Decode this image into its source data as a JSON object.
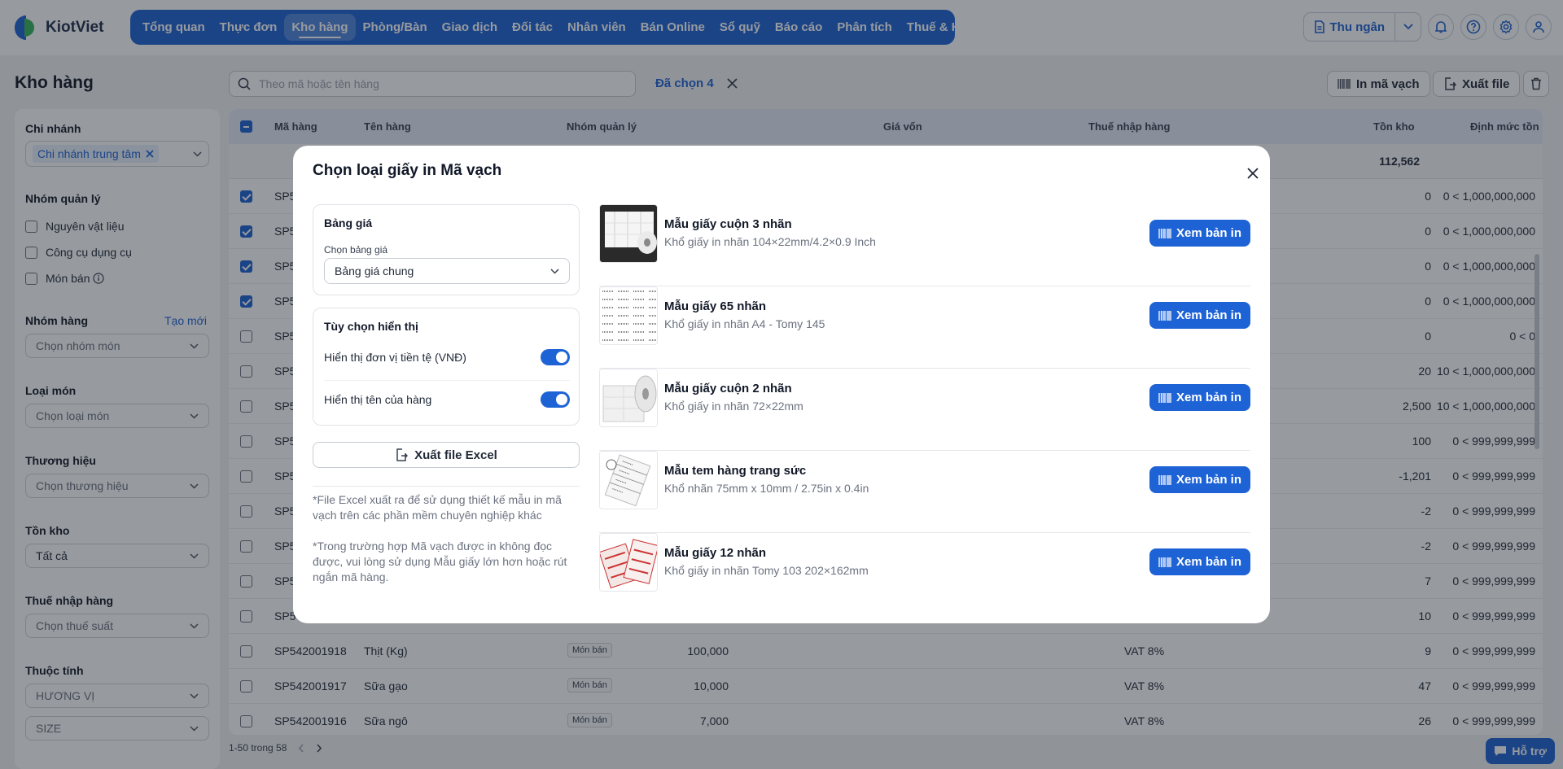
{
  "app": {
    "brand": "KiotViet"
  },
  "nav": [
    {
      "label": "Tổng quan"
    },
    {
      "label": "Thực đơn"
    },
    {
      "label": "Kho hàng",
      "active": true
    },
    {
      "label": "Phòng/Bàn"
    },
    {
      "label": "Giao dịch"
    },
    {
      "label": "Đối tác"
    },
    {
      "label": "Nhân viên"
    },
    {
      "label": "Bán Online"
    },
    {
      "label": "Sổ quỹ"
    },
    {
      "label": "Báo cáo"
    },
    {
      "label": "Phân tích"
    },
    {
      "label": "Thuế & Kế toán"
    }
  ],
  "topright": {
    "cashier_label": "Thu ngân"
  },
  "page": {
    "title": "Kho hàng"
  },
  "filters": {
    "branch": {
      "title": "Chi nhánh",
      "chip": "Chi nhánh trung tâm"
    },
    "mgmt_group": {
      "title": "Nhóm quản lý",
      "options": [
        "Nguyên vật liệu",
        "Công cụ dụng cụ",
        "Món bán"
      ]
    },
    "product_group": {
      "title": "Nhóm hàng",
      "create": "Tạo mới",
      "placeholder": "Chọn nhóm món"
    },
    "dish_type": {
      "title": "Loại món",
      "placeholder": "Chọn loại món"
    },
    "brand": {
      "title": "Thương hiệu",
      "placeholder": "Chọn thương hiệu"
    },
    "stock": {
      "title": "Tồn kho",
      "value": "Tất cả"
    },
    "import_tax": {
      "title": "Thuế nhập hàng",
      "placeholder": "Chọn thuế suất"
    },
    "attributes": {
      "title": "Thuộc tính",
      "options": [
        "HƯƠNG VỊ",
        "SIZE"
      ]
    }
  },
  "toolbar": {
    "search_placeholder": "Theo mã hoặc tên hàng",
    "selected": "Đã chọn 4",
    "barcode_label": "In mã vạch",
    "export_label": "Xuất file"
  },
  "table": {
    "headers": [
      "Mã hàng",
      "Tên hàng",
      "Nhóm quản lý",
      "Giá vốn",
      "Thuế nhập hàng",
      "Tồn kho",
      "Định mức tồn"
    ],
    "total_stock": "112,562",
    "rows": [
      {
        "code": "SP5",
        "name": "",
        "group": "",
        "cost": "",
        "tax": "",
        "stock": "0",
        "norm": "0 < 1,000,000,000",
        "checked": true
      },
      {
        "code": "SP5",
        "name": "",
        "group": "",
        "cost": "",
        "tax": "",
        "stock": "0",
        "norm": "0 < 1,000,000,000",
        "checked": true
      },
      {
        "code": "SP5",
        "name": "",
        "group": "",
        "cost": "",
        "tax": "",
        "stock": "0",
        "norm": "0 < 1,000,000,000",
        "checked": true
      },
      {
        "code": "SP5",
        "name": "",
        "group": "",
        "cost": "",
        "tax": "",
        "stock": "0",
        "norm": "0 < 1,000,000,000",
        "checked": true
      },
      {
        "code": "SP5",
        "name": "",
        "group": "",
        "cost": "",
        "tax": "",
        "stock": "0",
        "norm": "0 < 0",
        "checked": false
      },
      {
        "code": "SP5",
        "name": "",
        "group": "",
        "cost": "",
        "tax": "",
        "stock": "20",
        "norm": "10 < 1,000,000,000",
        "checked": false
      },
      {
        "code": "SP5",
        "name": "",
        "group": "",
        "cost": "",
        "tax": "",
        "stock": "2,500",
        "norm": "10 < 1,000,000,000",
        "checked": false
      },
      {
        "code": "SP5",
        "name": "",
        "group": "",
        "cost": "",
        "tax": "",
        "stock": "100",
        "norm": "0 < 999,999,999",
        "checked": false
      },
      {
        "code": "SP5",
        "name": "",
        "group": "",
        "cost": "",
        "tax": "",
        "stock": "-1,201",
        "norm": "0 < 999,999,999",
        "checked": false
      },
      {
        "code": "SP5",
        "name": "",
        "group": "",
        "cost": "",
        "tax": "",
        "stock": "-2",
        "norm": "0 < 999,999,999",
        "checked": false
      },
      {
        "code": "SP5",
        "name": "",
        "group": "",
        "cost": "",
        "tax": "",
        "stock": "-2",
        "norm": "0 < 999,999,999",
        "checked": false
      },
      {
        "code": "SP5",
        "name": "",
        "group": "",
        "cost": "",
        "tax": "",
        "stock": "7",
        "norm": "0 < 999,999,999",
        "checked": false
      },
      {
        "code": "SP5",
        "name": "",
        "group": "",
        "cost": "",
        "tax": "",
        "stock": "10",
        "norm": "0 < 999,999,999",
        "checked": false
      },
      {
        "code": "SP542001918",
        "name": "Thịt (Kg)",
        "group": "Món bán",
        "cost": "100,000",
        "tax": "VAT 8%",
        "stock": "9",
        "norm": "0 < 999,999,999",
        "checked": false
      },
      {
        "code": "SP542001917",
        "name": "Sữa gạo",
        "group": "Món bán",
        "cost": "10,000",
        "tax": "VAT 8%",
        "stock": "47",
        "norm": "0 < 999,999,999",
        "checked": false
      },
      {
        "code": "SP542001916",
        "name": "Sữa ngô",
        "group": "Món bán",
        "cost": "7,000",
        "tax": "VAT 8%",
        "stock": "26",
        "norm": "0 < 999,999,999",
        "checked": false
      }
    ]
  },
  "pager": {
    "text": "1-50 trong 58"
  },
  "help": {
    "label": "Hỗ trợ"
  },
  "modal": {
    "title": "Chọn loại giấy in Mã vạch",
    "price_card": {
      "title": "Bảng giá",
      "label": "Chọn bảng giá",
      "value": "Bảng giá chung"
    },
    "display_card": {
      "title": "Tùy chọn hiển thị",
      "toggles": [
        {
          "label": "Hiển thị đơn vị tiền tệ (VNĐ)",
          "on": true
        },
        {
          "label": "Hiển thị tên của hàng",
          "on": true
        }
      ]
    },
    "export_label": "Xuất file Excel",
    "notes": [
      "*File Excel xuất ra để sử dụng thiết kế mẫu in mã vạch trên các phần mềm chuyên nghiệp khác",
      "*Trong trường hợp Mã vạch được in không đọc được, vui lòng sử dụng Mẫu giấy lớn hơn hoặc rút ngắn mã hàng."
    ],
    "papers": [
      {
        "name": "Mẫu giấy cuộn 3 nhãn",
        "desc": "Khổ giấy in nhãn 104×22mm/4.2×0.9 Inch",
        "button": "Xem bản in"
      },
      {
        "name": "Mẫu giấy 65 nhãn",
        "desc": "Khổ giấy in nhãn A4 - Tomy 145",
        "button": "Xem bản in"
      },
      {
        "name": "Mẫu giấy cuộn 2 nhãn",
        "desc": "Khổ giấy in nhãn 72×22mm",
        "button": "Xem bản in"
      },
      {
        "name": "Mẫu tem hàng trang sức",
        "desc": "Khổ nhãn 75mm x 10mm / 2.75in x 0.4in",
        "button": "Xem bản in"
      },
      {
        "name": "Mẫu giấy 12 nhãn",
        "desc": "Khổ giấy in nhãn Tomy 103 202×162mm",
        "button": "Xem bản in"
      }
    ]
  }
}
